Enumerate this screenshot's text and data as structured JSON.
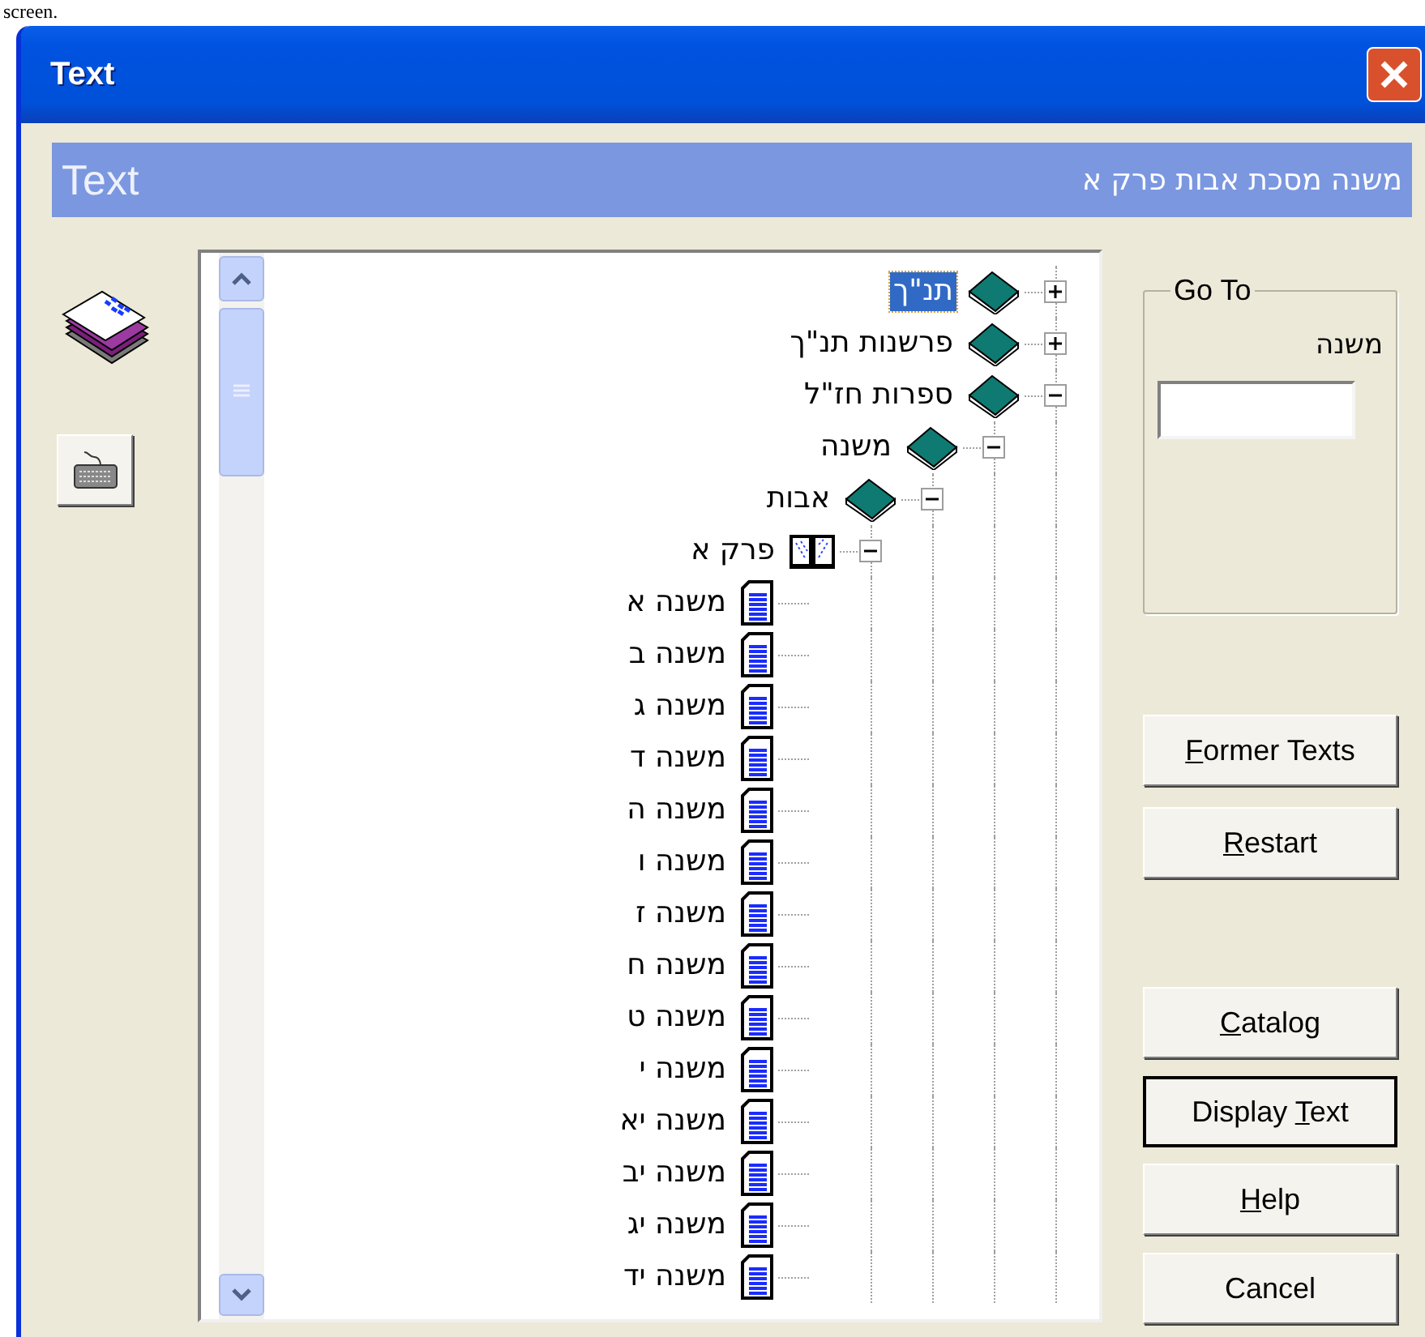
{
  "caption": "screen.",
  "window": {
    "title": "Text"
  },
  "header": {
    "title": "Text",
    "path": "משנה מסכת אבות פרק א"
  },
  "tree": [
    {
      "label": "תנ\"ך",
      "kind": "book",
      "selected": true,
      "expanded": false
    },
    {
      "label": "פרשנות תנ\"ך",
      "kind": "book",
      "selected": false,
      "expanded": false
    },
    {
      "label": "ספרות חז\"ל",
      "kind": "book",
      "selected": false,
      "expanded": true,
      "children": [
        {
          "label": "משנה",
          "kind": "book",
          "selected": false,
          "expanded": true,
          "children": [
            {
              "label": "אבות",
              "kind": "book",
              "selected": false,
              "expanded": true,
              "children": [
                {
                  "label": "פרק א",
                  "kind": "open-book",
                  "selected": false,
                  "expanded": true,
                  "children": [
                    {
                      "label": "משנה א",
                      "kind": "page",
                      "selected": false
                    },
                    {
                      "label": "משנה ב",
                      "kind": "page",
                      "selected": false
                    },
                    {
                      "label": "משנה ג",
                      "kind": "page",
                      "selected": false
                    },
                    {
                      "label": "משנה ד",
                      "kind": "page",
                      "selected": false
                    },
                    {
                      "label": "משנה ה",
                      "kind": "page",
                      "selected": false
                    },
                    {
                      "label": "משנה ו",
                      "kind": "page",
                      "selected": false
                    },
                    {
                      "label": "משנה ז",
                      "kind": "page",
                      "selected": false
                    },
                    {
                      "label": "משנה ח",
                      "kind": "page",
                      "selected": false
                    },
                    {
                      "label": "משנה ט",
                      "kind": "page",
                      "selected": false
                    },
                    {
                      "label": "משנה י",
                      "kind": "page",
                      "selected": false
                    },
                    {
                      "label": "משנה יא",
                      "kind": "page",
                      "selected": false
                    },
                    {
                      "label": "משנה יב",
                      "kind": "page",
                      "selected": false
                    },
                    {
                      "label": "משנה יג",
                      "kind": "page",
                      "selected": false
                    },
                    {
                      "label": "משנה יד",
                      "kind": "page",
                      "selected": false
                    }
                  ]
                }
              ]
            }
          ]
        }
      ]
    }
  ],
  "goto": {
    "legend": "Go To",
    "label": "משנה"
  },
  "buttons": [
    {
      "accelerator": "F",
      "rest": "ormer Texts",
      "default": false
    },
    {
      "accelerator": "R",
      "rest": "estart",
      "default": false
    },
    {
      "accelerator": "C",
      "rest": "atalog",
      "default": false
    },
    {
      "before": "Display ",
      "accelerator": "T",
      "rest": "ext",
      "default": true
    },
    {
      "accelerator": "H",
      "rest": "elp",
      "default": false
    },
    {
      "rest": "Cancel",
      "default": false
    }
  ]
}
